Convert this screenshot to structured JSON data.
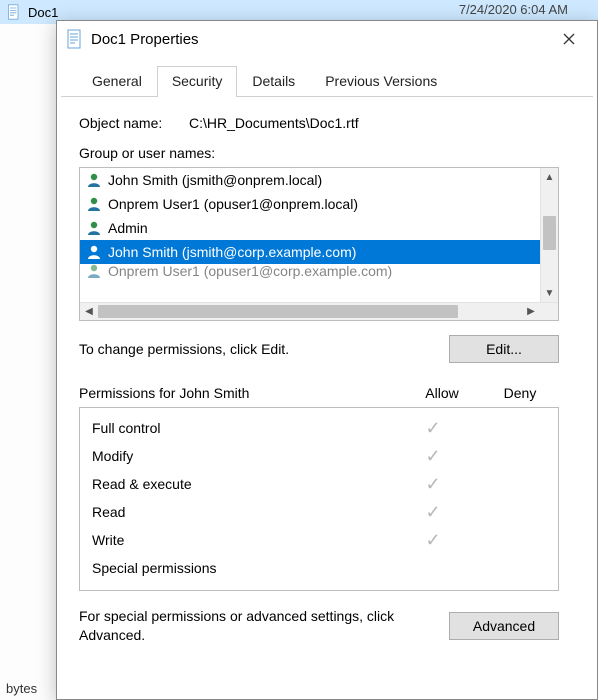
{
  "background": {
    "file_name": "Doc1",
    "timestamp": "7/24/2020 6:04 AM",
    "bytes_label": "bytes"
  },
  "dialog": {
    "title": "Doc1 Properties",
    "tabs": [
      {
        "label": "General"
      },
      {
        "label": "Security"
      },
      {
        "label": "Details"
      },
      {
        "label": "Previous Versions"
      }
    ],
    "active_tab_index": 1,
    "object_name_label": "Object name:",
    "object_name_value": "C:\\HR_Documents\\Doc1.rtf",
    "group_label": "Group or user names:",
    "users": [
      {
        "display": "John Smith (jsmith@onprem.local)",
        "selected": false
      },
      {
        "display": "Onprem User1 (opuser1@onprem.local)",
        "selected": false
      },
      {
        "display": "Admin",
        "selected": false
      },
      {
        "display": "John Smith (jsmith@corp.example.com)",
        "selected": true
      },
      {
        "display": "Onprem User1 (opuser1@corp.example.com)",
        "selected": false,
        "clipped": true
      }
    ],
    "edit_hint": "To change permissions, click Edit.",
    "edit_button": "Edit...",
    "perm_header_label": "Permissions for John Smith",
    "columns": {
      "allow": "Allow",
      "deny": "Deny"
    },
    "permissions": [
      {
        "name": "Full control",
        "allow": true,
        "deny": false
      },
      {
        "name": "Modify",
        "allow": true,
        "deny": false
      },
      {
        "name": "Read & execute",
        "allow": true,
        "deny": false
      },
      {
        "name": "Read",
        "allow": true,
        "deny": false
      },
      {
        "name": "Write",
        "allow": true,
        "deny": false
      },
      {
        "name": "Special permissions",
        "allow": false,
        "deny": false
      }
    ],
    "advanced_hint": "For special permissions or advanced settings, click Advanced.",
    "advanced_button": "Advanced"
  },
  "colors": {
    "selection": "#0078d7",
    "check": "#b7b7b7"
  }
}
